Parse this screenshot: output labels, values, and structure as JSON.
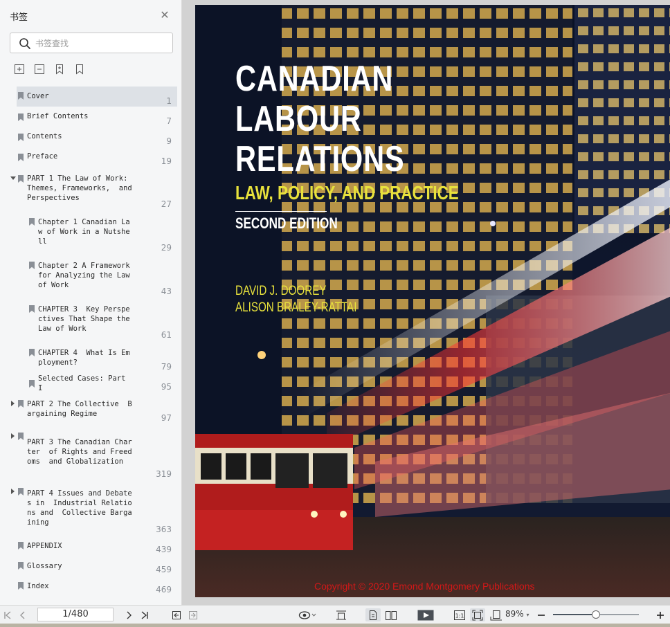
{
  "sidebar": {
    "title": "书签",
    "search_placeholder": "书签查找",
    "bookmarks": [
      {
        "label": "Cover",
        "page": "1",
        "selected": true
      },
      {
        "label": "Brief Contents",
        "page": "7"
      },
      {
        "label": "Contents",
        "page": "9"
      },
      {
        "label": "Preface",
        "page": "19"
      },
      {
        "label": "PART 1 The Law of Work:\nThemes, Frameworks,  and\nPerspectives",
        "page": "27",
        "expanded": true
      },
      {
        "label": "Chapter 1 Canadian La\nw of Work in a Nutshe\nll",
        "page": "29"
      },
      {
        "label": "Chapter 2 A Framework\nfor Analyzing the Law\nof Work",
        "page": "43"
      },
      {
        "label": "CHAPTER 3  Key Perspe\nctives That Shape the\nLaw of Work",
        "page": "61"
      },
      {
        "label": "CHAPTER 4  What Is Em\nployment?",
        "page": "79"
      },
      {
        "label": "Selected Cases: Part\nI",
        "page": "95"
      },
      {
        "label": "PART 2 The Collective  B\nargaining Regime",
        "page": "97",
        "expanded": false
      },
      {
        "label": "PART 3 The Canadian Char\nter  of Rights and Freed\noms  and Globalization",
        "page": "319",
        "expanded": false
      },
      {
        "label": "PART 4 Issues and Debate\ns in  Industrial Relatio\nns and  Collective Barga\nining",
        "page": "363",
        "expanded": false
      },
      {
        "label": "APPENDIX",
        "page": "439"
      },
      {
        "label": "Glossary",
        "page": "459"
      },
      {
        "label": "Index",
        "page": "469"
      }
    ]
  },
  "cover": {
    "title_line1": "CANADIAN",
    "title_line2": "LABOUR",
    "title_line3": "RELATIONS",
    "subtitle": "LAW, POLICY, AND PRACTICE",
    "edition": "SECOND EDITION",
    "author1": "DAVID J. DOOREY",
    "author2": "ALISON BRALEY-RATTAI",
    "copyright": "Copyright © 2020 Emond Montgomery Publications"
  },
  "toolbar": {
    "page_indicator": "1/480",
    "zoom": "89%",
    "zoom_fraction": 0.5
  }
}
